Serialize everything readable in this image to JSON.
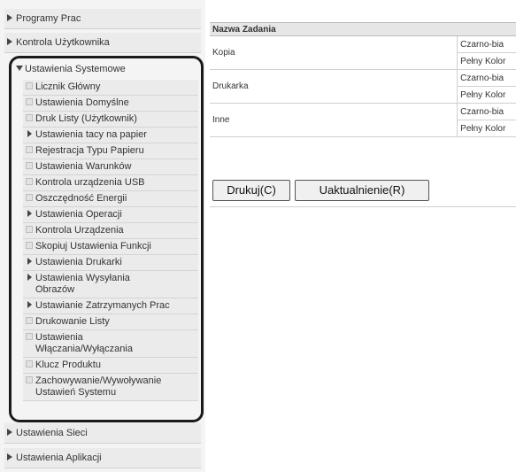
{
  "sidebar": {
    "top_items": [
      {
        "label": "Programy Prac"
      },
      {
        "label": "Kontrola Użytkownika"
      }
    ],
    "system_settings": {
      "label": "Ustawienia Systemowe",
      "items": [
        {
          "label": "Licznik Główny",
          "icon": "square-bullet-icon"
        },
        {
          "label": "Ustawienia Domyślne",
          "icon": "square-bullet-icon"
        },
        {
          "label": "Druk Listy (Użytkownik)",
          "icon": "square-bullet-icon"
        },
        {
          "label": "Ustawienia tacy na papier",
          "icon": "arrow-right-icon"
        },
        {
          "label": "Rejestracja Typu Papieru",
          "icon": "square-bullet-icon"
        },
        {
          "label": "Ustawienia Warunków",
          "icon": "square-bullet-icon"
        },
        {
          "label": "Kontrola urządzenia USB",
          "icon": "square-bullet-icon"
        },
        {
          "label": "Oszczędność Energii",
          "icon": "square-bullet-icon"
        },
        {
          "label": "Ustawienia Operacji",
          "icon": "arrow-right-icon"
        },
        {
          "label": "Kontrola Urządzenia",
          "icon": "square-bullet-icon"
        },
        {
          "label": "Skopiuj Ustawienia Funkcji",
          "icon": "square-bullet-icon"
        },
        {
          "label": "Ustawienia Drukarki",
          "icon": "arrow-right-icon"
        },
        {
          "line1": "Ustawienia Wysyłania",
          "line2": "Obrazów",
          "icon": "arrow-right-icon"
        },
        {
          "label": "Ustawianie Zatrzymanych Prac",
          "icon": "arrow-right-icon"
        },
        {
          "label": "Drukowanie Listy",
          "icon": "square-bullet-icon"
        },
        {
          "line1": "Ustawienia",
          "line2": "Włączania/Wyłączania",
          "icon": "square-bullet-icon"
        },
        {
          "label": "Klucz Produktu",
          "icon": "square-bullet-icon"
        },
        {
          "line1": "Zachowywanie/Wywoływanie",
          "line2": "Ustawień Systemu",
          "icon": "square-bullet-icon"
        }
      ]
    },
    "bottom_items": [
      {
        "label": "Ustawienia Sieci"
      },
      {
        "label": "Ustawienia Aplikacji"
      }
    ]
  },
  "main": {
    "table": {
      "header": "Nazwa Zadania",
      "groups": [
        {
          "category": "Kopia",
          "modes": [
            "Czarno-bia",
            "Pełny Kolor"
          ]
        },
        {
          "category": "Drukarka",
          "modes": [
            "Czarno-bia",
            "Pełny Kolor"
          ]
        },
        {
          "category": "Inne",
          "modes": [
            "Czarno-bia",
            "Pełny Kolor"
          ]
        }
      ]
    },
    "buttons": {
      "print": "Drukuj(C)",
      "update": "Uaktualnienie(R)"
    }
  }
}
